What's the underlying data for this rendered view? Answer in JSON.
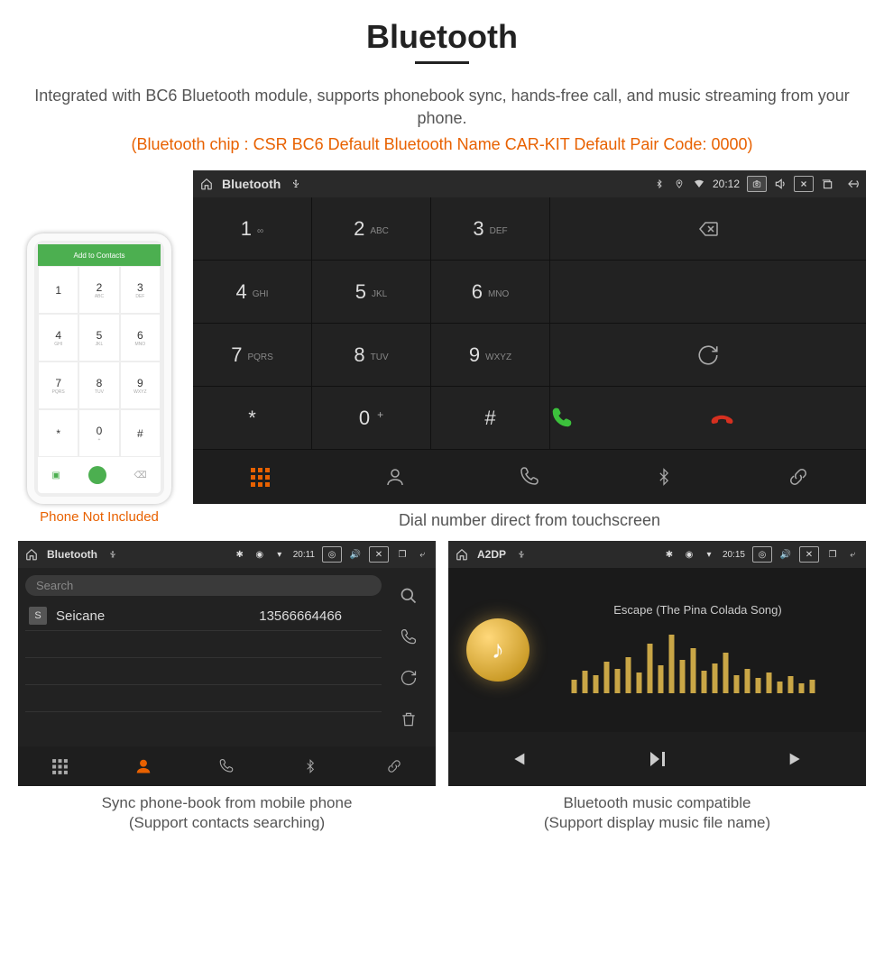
{
  "header": {
    "title": "Bluetooth",
    "desc": "Integrated with BC6 Bluetooth module, supports phonebook sync, hands-free call, and music streaming from your phone.",
    "spec": "(Bluetooth chip : CSR BC6    Default Bluetooth Name CAR-KIT    Default Pair Code: 0000)"
  },
  "phone_mock": {
    "topbar": "Add to Contacts",
    "caption": "Phone Not Included",
    "keys": [
      {
        "n": "1",
        "l": ""
      },
      {
        "n": "2",
        "l": "ABC"
      },
      {
        "n": "3",
        "l": "DEF"
      },
      {
        "n": "4",
        "l": "GHI"
      },
      {
        "n": "5",
        "l": "JKL"
      },
      {
        "n": "6",
        "l": "MNO"
      },
      {
        "n": "7",
        "l": "PQRS"
      },
      {
        "n": "8",
        "l": "TUV"
      },
      {
        "n": "9",
        "l": "WXYZ"
      },
      {
        "n": "*",
        "l": ""
      },
      {
        "n": "0",
        "l": "+"
      },
      {
        "n": "#",
        "l": ""
      }
    ]
  },
  "dial": {
    "statusbar": {
      "title": "Bluetooth",
      "time": "20:12"
    },
    "keys": [
      {
        "n": "1",
        "l": "∞"
      },
      {
        "n": "2",
        "l": "ABC"
      },
      {
        "n": "3",
        "l": "DEF"
      },
      {
        "n": "4",
        "l": "GHI"
      },
      {
        "n": "5",
        "l": "JKL"
      },
      {
        "n": "6",
        "l": "MNO"
      },
      {
        "n": "7",
        "l": "PQRS"
      },
      {
        "n": "8",
        "l": "TUV"
      },
      {
        "n": "9",
        "l": "WXYZ"
      },
      {
        "n": "*",
        "l": ""
      },
      {
        "n": "0",
        "l": "",
        "sup": "+"
      },
      {
        "n": "#",
        "l": ""
      }
    ],
    "caption": "Dial number direct from touchscreen"
  },
  "contacts": {
    "statusbar": {
      "title": "Bluetooth",
      "time": "20:11"
    },
    "search_placeholder": "Search",
    "rows": [
      {
        "badge": "S",
        "name": "Seicane",
        "number": "13566664466"
      }
    ],
    "caption_l1": "Sync phone-book from mobile phone",
    "caption_l2": "(Support contacts searching)"
  },
  "music": {
    "statusbar": {
      "title": "A2DP",
      "time": "20:15"
    },
    "song": "Escape (The Pina Colada Song)",
    "caption_l1": "Bluetooth music compatible",
    "caption_l2": "(Support display music file name)"
  }
}
